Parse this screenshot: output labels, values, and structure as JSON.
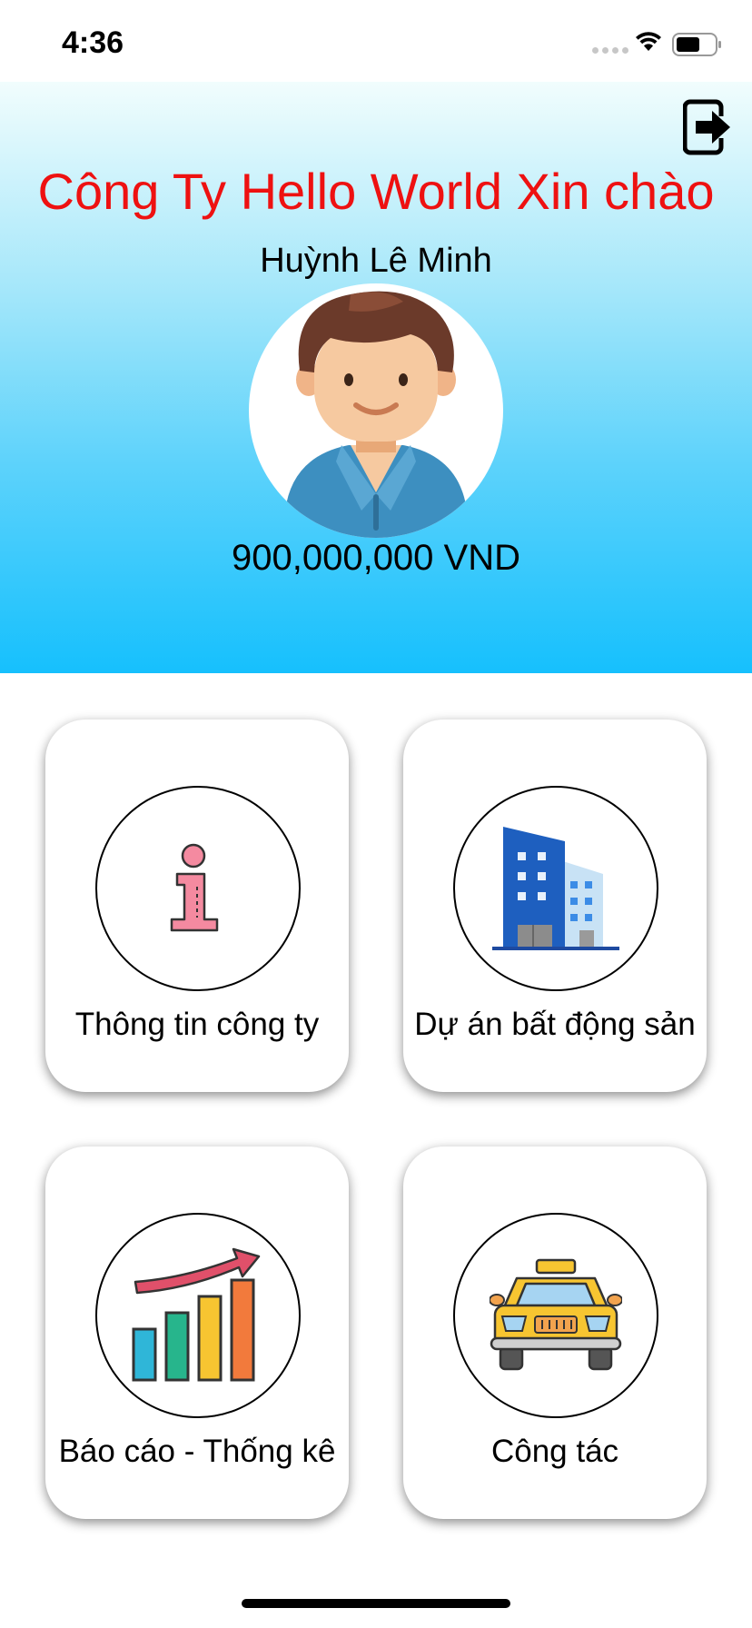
{
  "status_bar": {
    "time": "4:36"
  },
  "header": {
    "company_title": "Công Ty Hello World Xin chào",
    "user_name": "Huỳnh Lê Minh",
    "balance": "900,000,000 VND",
    "title_color": "#ee1111",
    "gradient_colors": [
      "#f1fdfd",
      "#a5e7fa",
      "#5cd2fb",
      "#16c0fd"
    ],
    "logout_icon": "logout-icon",
    "avatar_icon": "male-avatar-icon"
  },
  "menu": {
    "items": [
      {
        "label": "Thông tin công ty",
        "icon": "info-icon"
      },
      {
        "label": "Dự án bất động sản",
        "icon": "building-icon"
      },
      {
        "label": "Báo cáo - Thống kê",
        "icon": "bar-chart-icon"
      },
      {
        "label": "Công tác",
        "icon": "taxi-icon"
      }
    ]
  }
}
